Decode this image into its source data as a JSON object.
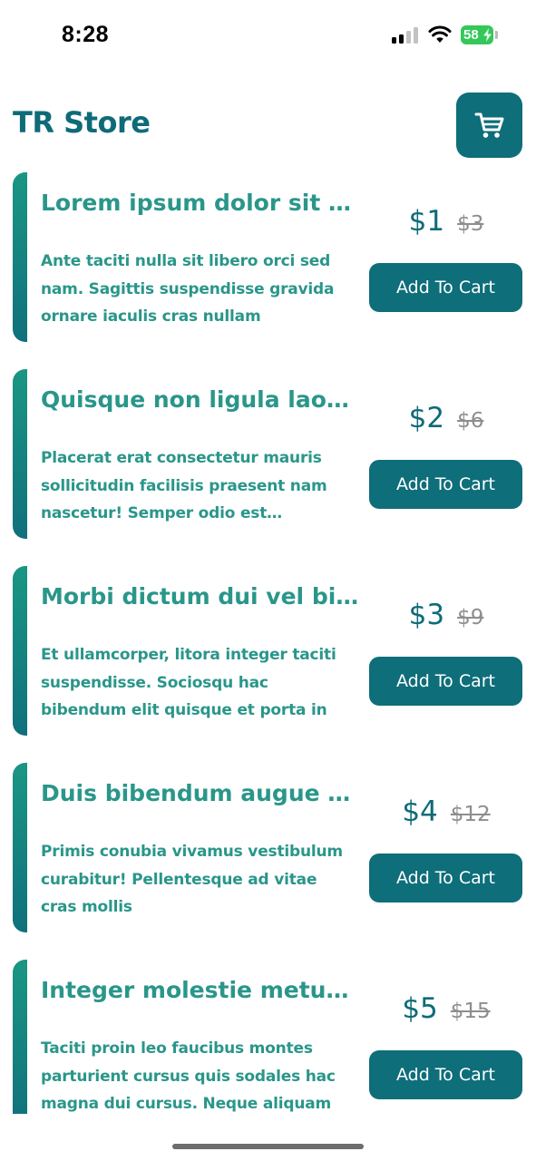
{
  "status_bar": {
    "time": "8:28",
    "battery": "58"
  },
  "header": {
    "title": "TR Store",
    "cart_icon": "cart-icon"
  },
  "colors": {
    "primary": "#0e6e7a",
    "text_accent": "#2a968a",
    "old_price": "#8e8e8e"
  },
  "products": [
    {
      "title": "Lorem ipsum dolor sit amet",
      "description": "Ante taciti nulla sit libero orci sed nam. Sagittis suspendisse gravida ornare iaculis cras nullam",
      "price": "$1",
      "old_price": "$3",
      "button_label": "Add To Cart"
    },
    {
      "title": "Quisque non ligula laoreet",
      "description": "Placerat erat consectetur mauris sollicitudin facilisis praesent nam nascetur! Semper odio est condimentum",
      "price": "$2",
      "old_price": "$6",
      "button_label": "Add To Cart"
    },
    {
      "title": "Morbi dictum dui vel bibendum",
      "description": "Et ullamcorper, litora integer taciti suspendisse. Sociosqu hac bibendum elit quisque et porta in",
      "price": "$3",
      "old_price": "$9",
      "button_label": "Add To Cart"
    },
    {
      "title": "Duis bibendum augue eget",
      "description": "Primis conubia vivamus vestibulum curabitur! Pellentesque ad vitae cras mollis",
      "price": "$4",
      "old_price": "$12",
      "button_label": "Add To Cart"
    },
    {
      "title": "Integer molestie metus quis",
      "description": "Taciti proin leo faucibus montes parturient cursus quis sodales hac magna dui cursus. Neque aliquam",
      "price": "$5",
      "old_price": "$15",
      "button_label": "Add To Cart"
    }
  ]
}
